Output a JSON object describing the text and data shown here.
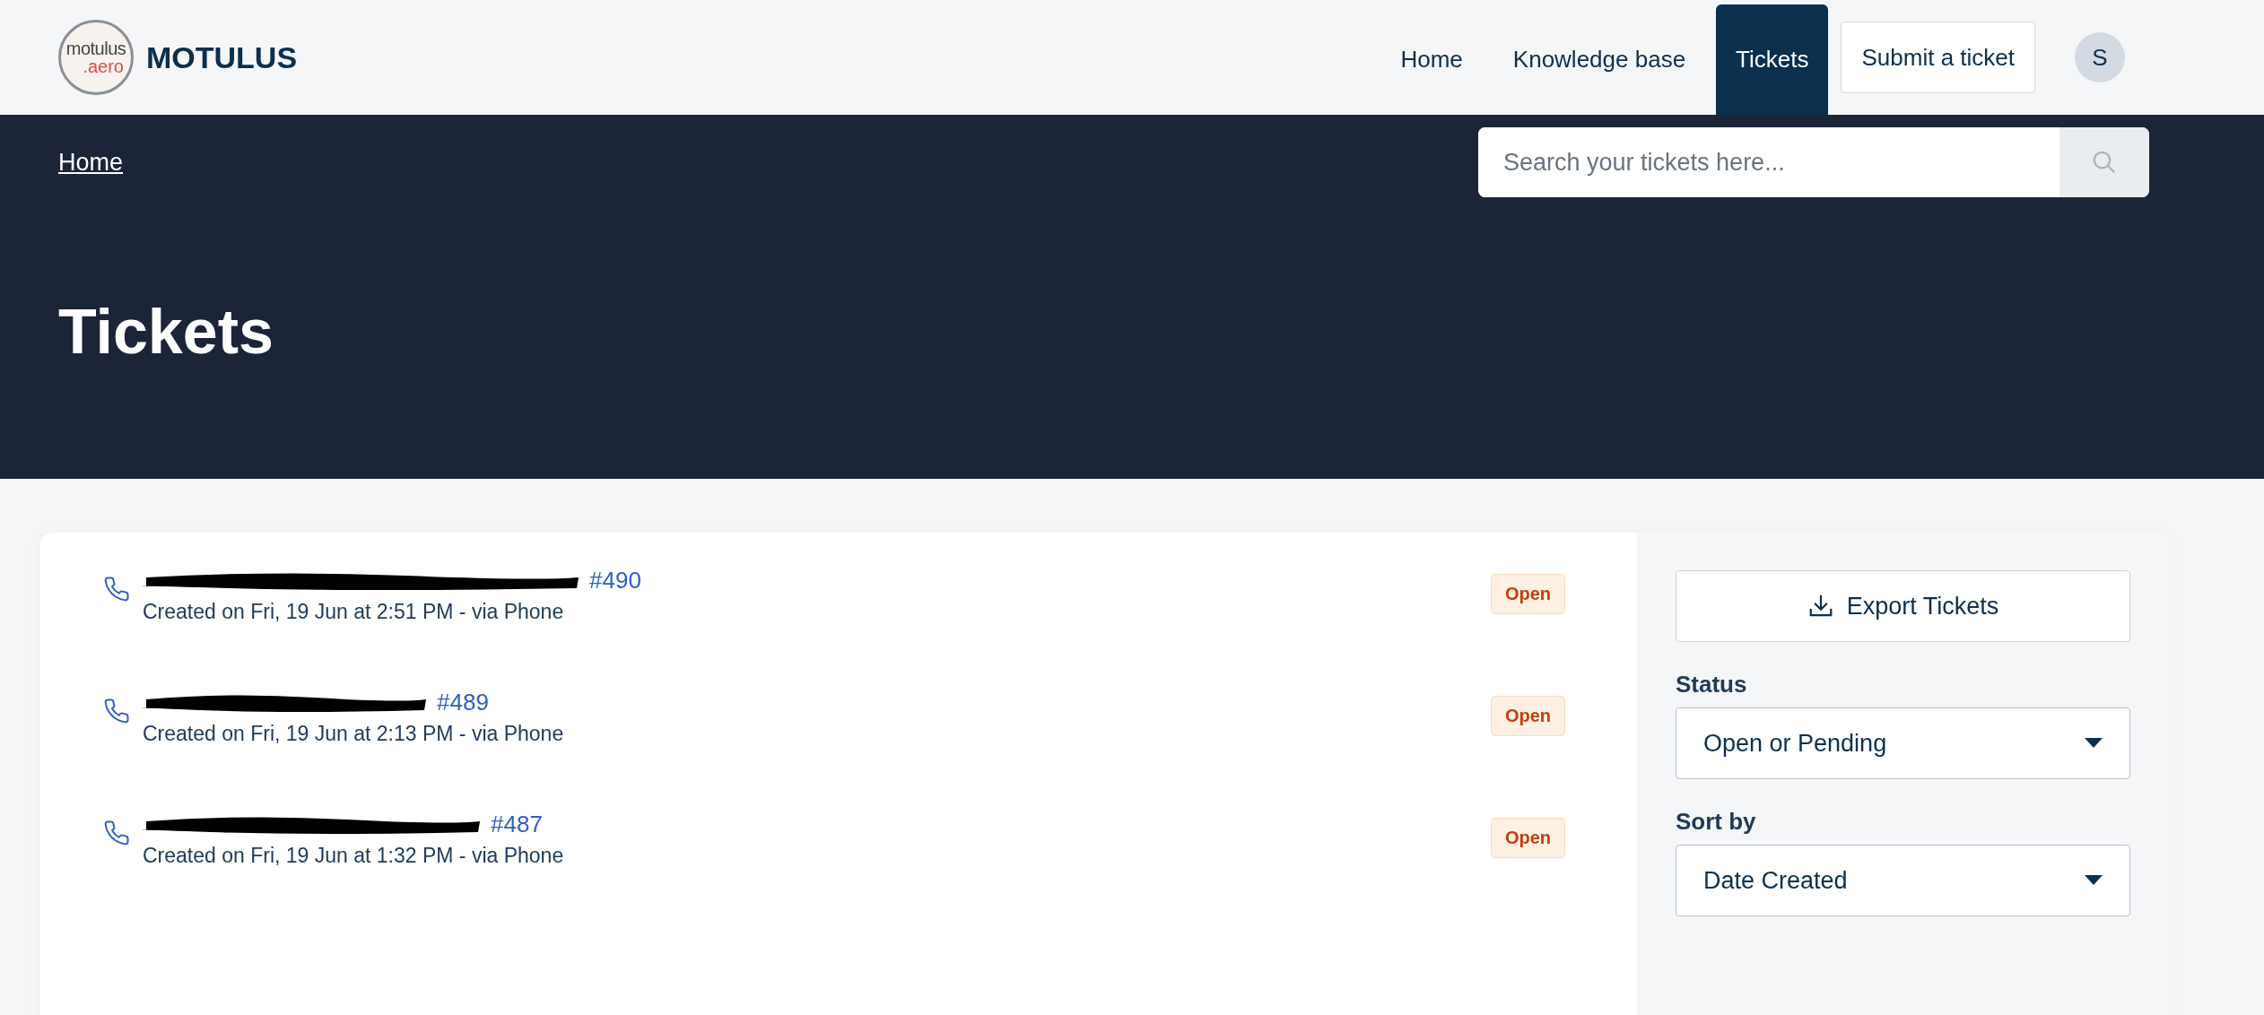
{
  "header": {
    "brand": "MOTULUS",
    "logo": {
      "line_1": "motulus",
      "line_2": ".aero"
    },
    "nav": [
      {
        "label": "Home",
        "selected": false
      },
      {
        "label": "Knowledge base",
        "selected": false
      },
      {
        "label": "Tickets",
        "selected": true
      }
    ],
    "submit_button": "Submit a ticket",
    "avatar": "S"
  },
  "hero": {
    "breadcrumb": "Home",
    "search": {
      "placeholder": "Search your tickets here..."
    },
    "title": "Tickets"
  },
  "tickets": [
    {
      "title": "#490",
      "meta": "Created on Fri, 19 Jun at 2:51 PM - via Phone",
      "status": "Open"
    },
    {
      "title": "#489",
      "meta": "Created on Fri, 19 Jun at 2:13 PM - via Phone",
      "status": "Open"
    },
    {
      "title": "#487",
      "meta": "Created on Fri, 19 Jun at 1:32 PM - via Phone",
      "status": "Open"
    }
  ],
  "sidebar": {
    "export_button": "Export Tickets",
    "filters": [
      {
        "label": "Status",
        "value": "Open or Pending"
      },
      {
        "label": "Sort by",
        "value": "Date Created"
      }
    ]
  }
}
